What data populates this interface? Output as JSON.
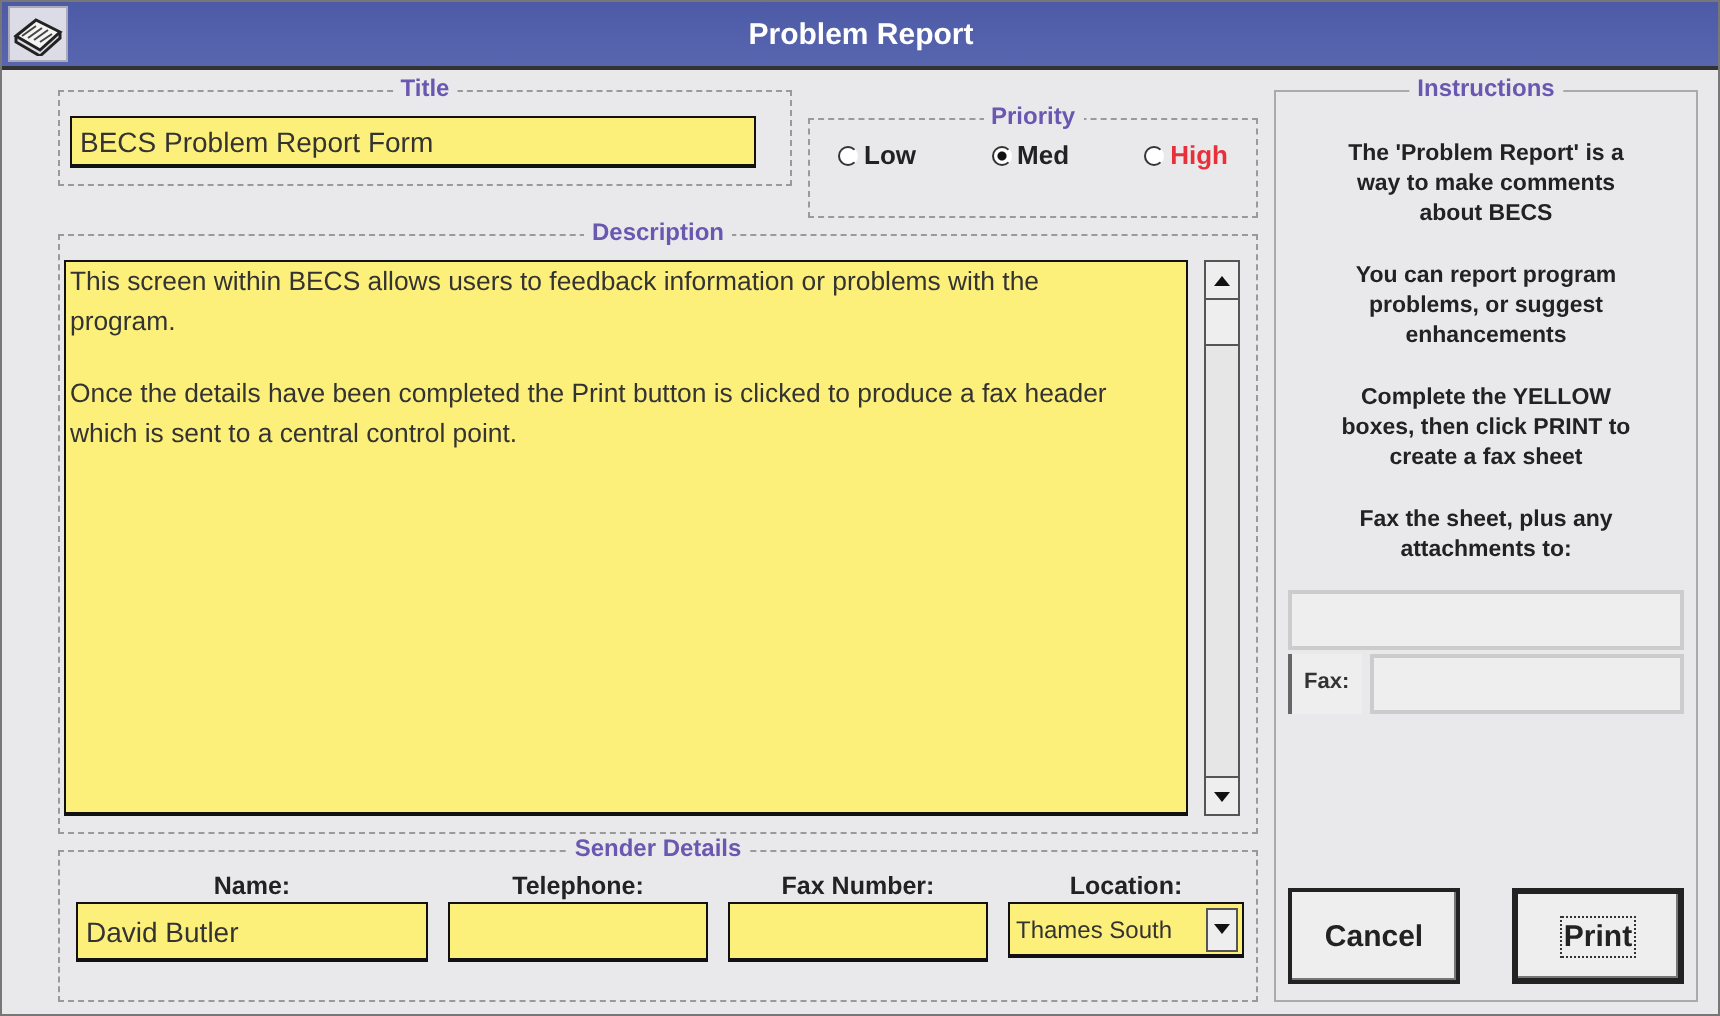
{
  "window": {
    "title": "Problem Report"
  },
  "title_group": {
    "legend": "Title",
    "value": "BECS Problem Report Form"
  },
  "priority": {
    "legend": "Priority",
    "options": [
      {
        "label": "Low",
        "selected": false,
        "color": "#222222"
      },
      {
        "label": "Med",
        "selected": true,
        "color": "#222222"
      },
      {
        "label": "High",
        "selected": false,
        "color": "#e8303a"
      }
    ]
  },
  "description": {
    "legend": "Description",
    "paragraphs": [
      "This screen within BECS allows users to feedback information or problems with the program.",
      "Once the details have been completed the Print button is clicked to produce a fax header which is sent to a central control point."
    ]
  },
  "sender": {
    "legend": "Sender Details",
    "fields": [
      {
        "label": "Name:",
        "value": "David Butler",
        "kind": "text"
      },
      {
        "label": "Telephone:",
        "kind": "text"
      },
      {
        "label": "Fax Number:",
        "kind": "text"
      },
      {
        "label": "Location:",
        "value": "Thames South",
        "kind": "dropdown"
      }
    ]
  },
  "instructions": {
    "legend": "Instructions",
    "paragraphs": [
      "The 'Problem Report' is a way to make comments about BECS",
      "You can report program problems, or suggest enhancements",
      "Complete the YELLOW boxes, then click PRINT to create a fax sheet",
      "Fax the sheet, plus any attachments to:"
    ],
    "fax_label": "Fax:"
  },
  "buttons": [
    {
      "label": "Cancel",
      "kind": "plain"
    },
    {
      "label": "Print",
      "kind": "default"
    }
  ]
}
